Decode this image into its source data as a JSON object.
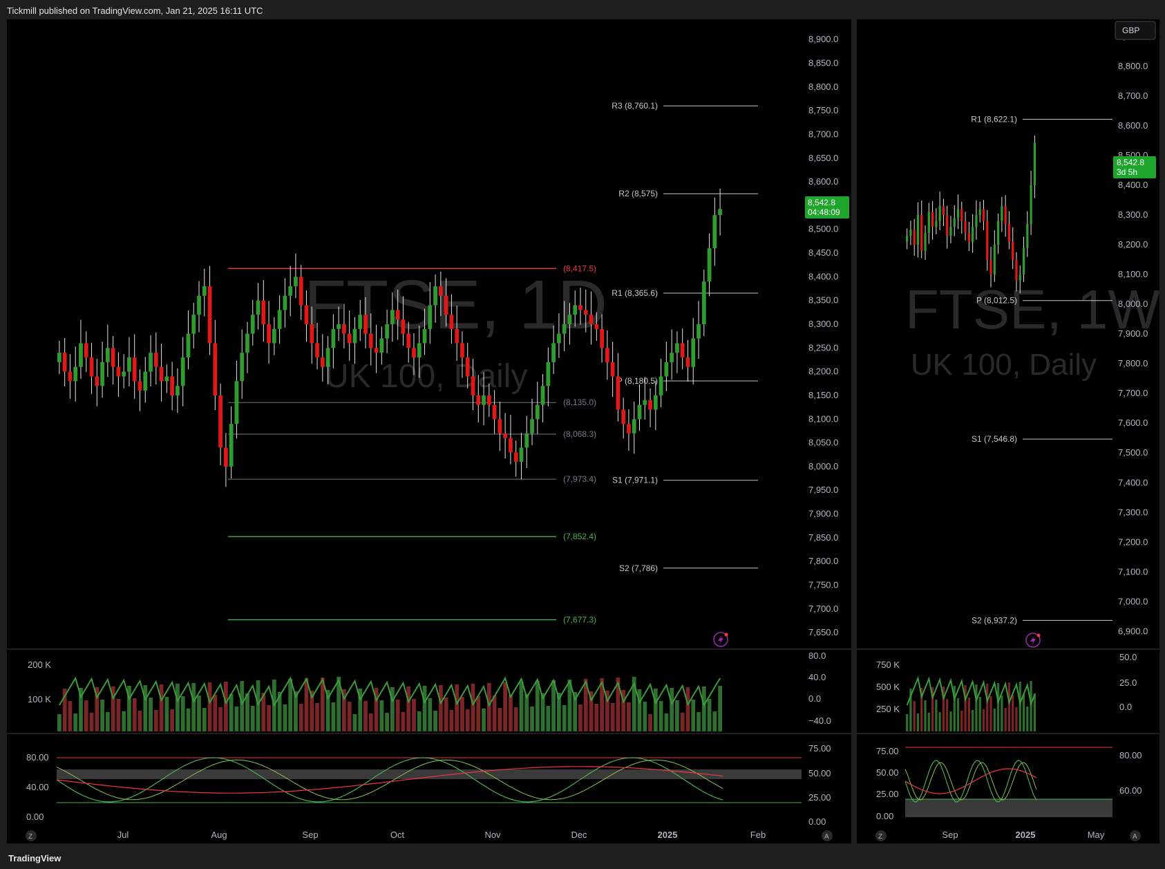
{
  "header": {
    "publisher_line": "Tickmill published on TradingView.com, Jan 21, 2025 16:11 UTC"
  },
  "footer": {
    "brand": "TradingView"
  },
  "chart_data": [
    {
      "type": "candlestick",
      "panel": "left",
      "symbol_watermark": "FTSE, 1D",
      "subtitle_watermark": "UK 100, Daily",
      "y_ticks": [
        "8,900.0",
        "8,850.0",
        "8,800.0",
        "8,750.0",
        "8,700.0",
        "8,650.0",
        "8,600.0",
        "8,550.0",
        "8,500.0",
        "8,450.0",
        "8,400.0",
        "8,350.0",
        "8,300.0",
        "8,250.0",
        "8,200.0",
        "8,150.0",
        "8,100.0",
        "8,050.0",
        "8,000.0",
        "7,950.0",
        "7,900.0",
        "7,850.0",
        "7,800.0",
        "7,750.0",
        "7,700.0",
        "7,650.0"
      ],
      "ylim": [
        7640,
        8925
      ],
      "x_ticks": [
        "Jul",
        "Aug",
        "Sep",
        "Oct",
        "Nov",
        "Dec",
        "2025",
        "Feb"
      ],
      "last_price": "8,542.8",
      "countdown": "04:48:09",
      "pivot_labels": [
        {
          "label": "R3 (8,760.1)",
          "value": 8760.1
        },
        {
          "label": "R2 (8,575)",
          "value": 8575
        },
        {
          "label": "R1 (8,365.6)",
          "value": 8365.6
        },
        {
          "label": "P (8,180.5)",
          "value": 8180.5
        },
        {
          "label": "S1 (7,971.1)",
          "value": 7971.1
        },
        {
          "label": "S2 (7,786)",
          "value": 7786
        }
      ],
      "level_labels": [
        {
          "label": "(8,417.5)",
          "value": 8417.5,
          "color": "#f23645"
        },
        {
          "label": "(8,135.0)",
          "value": 8135.0,
          "color": "#787b86"
        },
        {
          "label": "(8,068.3)",
          "value": 8068.3,
          "color": "#787b86"
        },
        {
          "label": "(7,973.4)",
          "value": 7973.4,
          "color": "#787b86"
        },
        {
          "label": "(7,852.4)",
          "value": 7852.4,
          "color": "#4caf50"
        },
        {
          "label": "(7,677.3)",
          "value": 7677.3,
          "color": "#4caf50"
        }
      ],
      "closes_approx": [
        8240,
        8200,
        8180,
        8210,
        8260,
        8230,
        8190,
        8170,
        8220,
        8250,
        8210,
        8190,
        8200,
        8230,
        8180,
        8160,
        8200,
        8240,
        8210,
        8180,
        8190,
        8150,
        8170,
        8230,
        8280,
        8320,
        8360,
        8380,
        8260,
        8150,
        8040,
        8000,
        8090,
        8180,
        8240,
        8280,
        8320,
        8350,
        8300,
        8260,
        8290,
        8330,
        8360,
        8380,
        8400,
        8340,
        8300,
        8260,
        8230,
        8210,
        8250,
        8290,
        8300,
        8280,
        8260,
        8290,
        8320,
        8280,
        8250,
        8240,
        8270,
        8300,
        8330,
        8310,
        8280,
        8250,
        8230,
        8260,
        8290,
        8340,
        8380,
        8360,
        8320,
        8290,
        8260,
        8230,
        8190,
        8150,
        8130,
        8150,
        8130,
        8100,
        8070,
        8060,
        8030,
        8010,
        8040,
        8070,
        8100,
        8130,
        8170,
        8220,
        8260,
        8280,
        8300,
        8320,
        8340,
        8330,
        8320,
        8300,
        8290,
        8250,
        8220,
        8190,
        8120,
        8090,
        8070,
        8100,
        8130,
        8140,
        8120,
        8150,
        8190,
        8220,
        8240,
        8260,
        8230,
        8210,
        8270,
        8300,
        8390,
        8460,
        8530,
        8542.8
      ]
    },
    {
      "type": "volume_oscillator",
      "panel": "left",
      "y_ticks_left": [
        "200 K",
        "100 K"
      ],
      "y_ticks_right": [
        "80.0",
        "40.0",
        "0.0",
        "−40.0"
      ]
    },
    {
      "type": "stochastic",
      "panel": "left",
      "y_ticks_left": [
        "80.00",
        "40.00",
        "0.00"
      ],
      "y_ticks_right": [
        "75.00",
        "50.00",
        "25.00",
        "0.00"
      ]
    },
    {
      "type": "candlestick",
      "panel": "right",
      "symbol_watermark": "FTSE, 1W",
      "subtitle_watermark": "UK 100, Daily",
      "currency": "GBP",
      "y_ticks": [
        "8,900.0",
        "8,800.0",
        "8,700.0",
        "8,600.0",
        "8,500.0",
        "8,400.0",
        "8,300.0",
        "8,200.0",
        "8,100.0",
        "8,000.0",
        "7,900.0",
        "7,800.0",
        "7,700.0",
        "7,600.0",
        "7,500.0",
        "7,400.0",
        "7,300.0",
        "7,200.0",
        "7,100.0",
        "7,000.0",
        "6,900.0"
      ],
      "ylim": [
        6880,
        8930
      ],
      "x_ticks": [
        "Sep",
        "2025",
        "May"
      ],
      "last_price": "8,542.8",
      "countdown": "3d 5h",
      "pivot_labels": [
        {
          "label": "R1 (8,622.1)",
          "value": 8622.1
        },
        {
          "label": "P (8,012.5)",
          "value": 8012.5
        },
        {
          "label": "S1 (7,546.8)",
          "value": 7546.8
        },
        {
          "label": "S2 (6,937.2)",
          "value": 6937.2
        }
      ],
      "closes_approx": [
        8230,
        8250,
        8200,
        8300,
        8180,
        8240,
        8310,
        8260,
        8280,
        8330,
        8300,
        8230,
        8260,
        8290,
        8320,
        8280,
        8240,
        8210,
        8260,
        8300,
        8320,
        8280,
        8150,
        8100,
        8200,
        8280,
        8330,
        8270,
        8210,
        8150,
        8080,
        8100,
        8190,
        8270,
        8400,
        8542.8
      ]
    },
    {
      "type": "volume_oscillator",
      "panel": "right",
      "y_ticks_left": [
        "750 K",
        "500 K",
        "250 K"
      ],
      "y_ticks_right": [
        "50.0",
        "25.0",
        "0.0"
      ]
    },
    {
      "type": "stochastic",
      "panel": "right",
      "y_ticks_left": [
        "75.00",
        "50.00",
        "25.00",
        "0.00"
      ],
      "y_ticks_right": [
        "80.00",
        "60.00"
      ]
    }
  ],
  "colors": {
    "up": "#26a69a",
    "up_candle": "#2e9c2e",
    "down": "#f23645",
    "down_candle": "#e01818",
    "bg": "#000000",
    "axis_text": "#b2b5be",
    "price_label_bg": "#1ea62c"
  }
}
